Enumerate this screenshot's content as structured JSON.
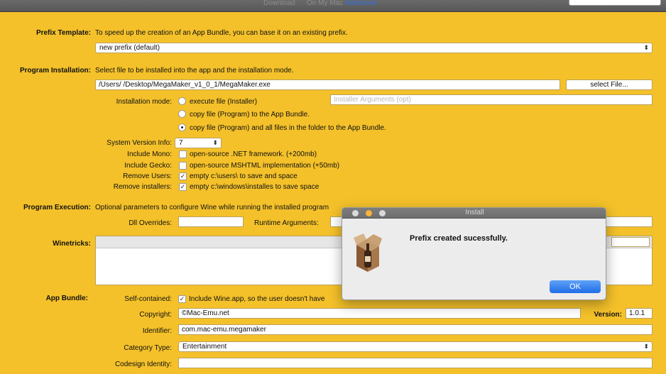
{
  "toolbar": {
    "tabs": [
      "Download",
      "On My Mac",
      "Advanced"
    ],
    "active_tab": "Advanced"
  },
  "prefix_template": {
    "label": "Prefix Template:",
    "description": "To speed up the creation of an App Bundle, you can base it on an existing prefix.",
    "selected": "new prefix (default)"
  },
  "program_installation": {
    "label": "Program Installation:",
    "description": "Select file to be installed into the app and the installation mode.",
    "file_path": "/Users/            /Desktop/MegaMaker_v1_0_1/MegaMaker.exe",
    "select_file_label": "select File...",
    "installation_mode_label": "Installation mode:",
    "modes": [
      "execute file (Installer)",
      "copy file (Program)  to the App Bundle.",
      "copy file (Program)  and all files in the folder to the App Bundle."
    ],
    "selected_mode": 2,
    "installer_args_placeholder": "Installer Arguments (opt)"
  },
  "options": {
    "system_version_label": "System Version Info:",
    "system_version": "7",
    "include_mono_label": "Include Mono:",
    "include_mono_text": "open-source .NET framework. (+200mb)",
    "include_gecko_label": "Include Gecko:",
    "include_gecko_text": "open-source MSHTML implementation (+50mb)",
    "remove_users_label": "Remove Users:",
    "remove_users_text": "empty c:\\users\\ to save and space",
    "remove_installers_label": "Remove installers:",
    "remove_installers_text": "empty c:\\windows\\installes to save space"
  },
  "program_execution": {
    "label": "Program Execution:",
    "description": "Optional parameters to configure Wine while running the installed program",
    "dll_overrides_label": "Dll Overrides:",
    "runtime_args_label": "Runtime Arguments:"
  },
  "winetricks": {
    "label": "Winetricks:"
  },
  "app_bundle": {
    "label": "App Bundle:",
    "self_contained_label": "Self-contained:",
    "self_contained_text": "Include Wine.app, so the user doesn't have",
    "copyright_label": "Copyright:",
    "copyright_value": "©Mac-Emu.net",
    "version_label": "Version:",
    "version_value": "1.0.1",
    "identifier_label": "Identifier:",
    "identifier_value": "com.mac-emu.megamaker",
    "category_label": "Category Type:",
    "category_value": "Entertainment",
    "codesign_label": "Codesign Identity:"
  },
  "dialog": {
    "title": "Install",
    "message": "Prefix created sucessfully.",
    "ok_label": "OK"
  },
  "colors": {
    "background": "#f4c12a",
    "accent_button": "#1f6de8"
  }
}
